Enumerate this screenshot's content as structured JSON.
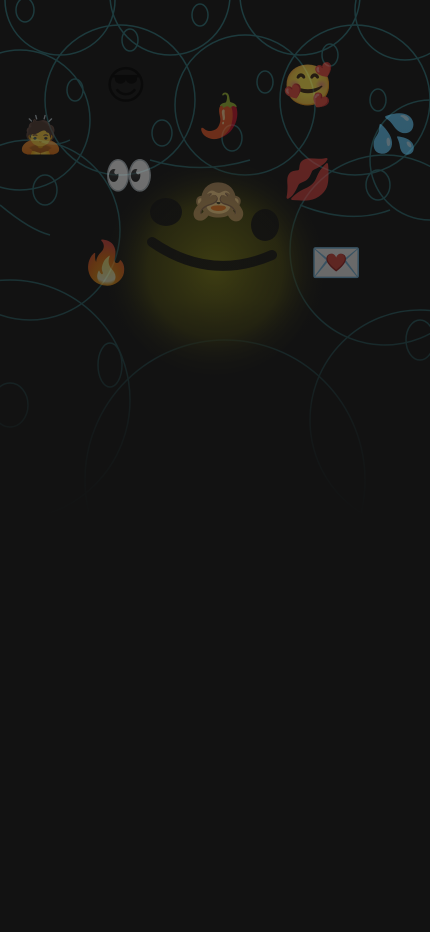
{
  "screen": {
    "background_color": "#121212",
    "theme": "dark"
  },
  "background_art": {
    "pattern_color": "#2a6b72",
    "highlight_face_color": "#5b5a12",
    "emojis": [
      {
        "name": "smiling-face-with-sunglasses",
        "glyph": "😎"
      },
      {
        "name": "hot-pepper",
        "glyph": "🌶️"
      },
      {
        "name": "smiling-face-with-hearts",
        "glyph": "🥰"
      },
      {
        "name": "sweat-droplets",
        "glyph": "💦"
      },
      {
        "name": "person-bowing",
        "glyph": "🙇"
      },
      {
        "name": "eyes",
        "glyph": "👀"
      },
      {
        "name": "see-no-evil-monkey",
        "glyph": "🙈"
      },
      {
        "name": "kiss-mark-lips",
        "glyph": "💋"
      },
      {
        "name": "fire",
        "glyph": "🔥"
      },
      {
        "name": "love-letter",
        "glyph": "💌"
      }
    ]
  }
}
